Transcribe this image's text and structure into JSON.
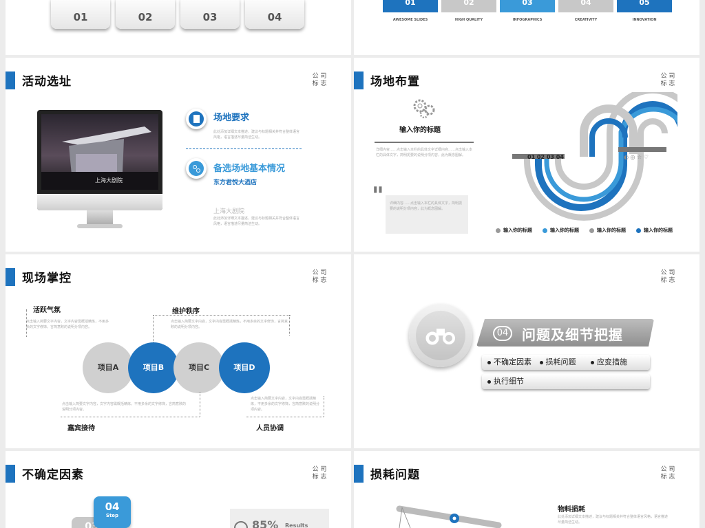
{
  "slide_tl": {
    "tabs": [
      "01",
      "02",
      "03",
      "04"
    ]
  },
  "slide_tr": {
    "categories": [
      {
        "num": "01",
        "label": "AWESOME SLIDES",
        "color": "#1e73be"
      },
      {
        "num": "02",
        "label": "HIGH QUALITY",
        "color": "#c8c8c8"
      },
      {
        "num": "03",
        "label": "INFOGRAPHICS",
        "color": "#3a9ad9"
      },
      {
        "num": "04",
        "label": "CREATIVITY",
        "color": "#c8c8c8"
      },
      {
        "num": "05",
        "label": "INNOVATION",
        "color": "#1e73be"
      }
    ]
  },
  "logo": {
    "line1": "公 司",
    "line2": "标 志"
  },
  "venue": {
    "title": "活动选址",
    "item1_title": "场地要求",
    "item1_text": "此处添加详细文本描述，建议与标题相关并符合整体语言风格，语言描述尽量简洁生动。",
    "item2_title": "备选场地基本情况",
    "item2_sub1": "东方君悦大酒店",
    "item2_sub2": "上海大剧院",
    "item2_text": "此处添加详细文本描述，建议与标题相关并符合整体语言风格，语言描述尽量简洁生动。",
    "theater_sign": "上海大剧院"
  },
  "layout_slide": {
    "title": "场地布置",
    "gear_label": "输入你的标题",
    "text1": "详细内容……点击输入本栏的具体文字详细内容……点击输入本栏的具体文字，简明扼要的说明分项内容，此为概念图解。",
    "text2": "详细内容……点击输入本栏的具体文字，简明扼要的说明分项内容，此为概念图解。",
    "steps": "01 02 03 04",
    "legend": [
      "输入你的标题",
      "输入你的标题",
      "输入你的标题",
      "输入你的标题"
    ]
  },
  "control": {
    "title": "现场掌控",
    "items": [
      "项目A",
      "项目B",
      "项目C",
      "项目D"
    ],
    "label_tl": "活跃气氛",
    "label_tm": "维护秩序",
    "label_bl": "嘉宾接待",
    "label_br": "人员协调",
    "text": "点击输入简要文字内容，文字内容需概括精炼，不用多余的文字修饰，言简意赅的说明分项内容。"
  },
  "section": {
    "num": "04",
    "title": "问题及细节把握",
    "bullets": [
      "不确定因素",
      "损耗问题",
      "应变措施"
    ],
    "bullet4": "执行细节"
  },
  "uncertain": {
    "title": "不确定因素",
    "step_num": "04",
    "step_label": "Step",
    "step_num2": "03",
    "percent": "85%",
    "results": "Results"
  },
  "loss": {
    "title": "损耗问题",
    "sub": "物料损耗",
    "text": "此处添加详细文本描述，建议与标题相关并符合整体语言风格，语言描述尽量简洁生动。"
  }
}
